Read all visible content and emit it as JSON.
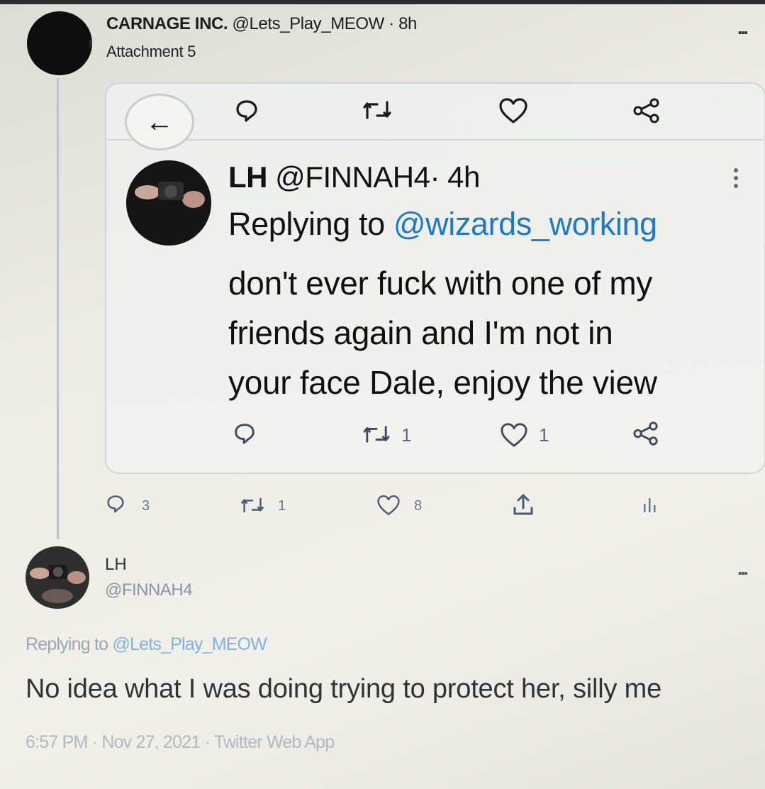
{
  "outer_tweet": {
    "display_name": "CARNAGE INC.",
    "handle": "@Lets_Play_MEOW",
    "time": "· 8h",
    "subtitle": "Attachment 5",
    "more": "...",
    "actions": {
      "reply_count": "3",
      "retweet_count": "1",
      "like_count": "8"
    }
  },
  "attached_tweet": {
    "display_name": "LH",
    "handle": "@FINNAH4",
    "time": "· 4h",
    "replying_prefix": "Replying to",
    "replying_to": "@wizards_working",
    "text_lines": [
      "don't ever fuck with one of my",
      "friends again and I'm not in",
      "your face Dale, enjoy the view"
    ],
    "actions": {
      "retweet_count": "1",
      "like_count": "1"
    },
    "back_glyph": "←"
  },
  "reply_tweet": {
    "display_name": "LH",
    "handle": "@FINNAH4",
    "more": "...",
    "replying_prefix": "Replying to",
    "replying_to": "@Lets_Play_MEOW",
    "text": "No idea what I was doing trying to protect her, silly me",
    "meta": "6:57 PM · Nov 27, 2021 · Twitter Web App"
  },
  "colors": {
    "accent": "#1e78c8",
    "icon": "#3b4a5e"
  },
  "icons": [
    "back-arrow-icon",
    "reply-icon",
    "retweet-icon",
    "like-icon",
    "share-icon",
    "more-icon",
    "analytics-icon",
    "upload-icon"
  ]
}
